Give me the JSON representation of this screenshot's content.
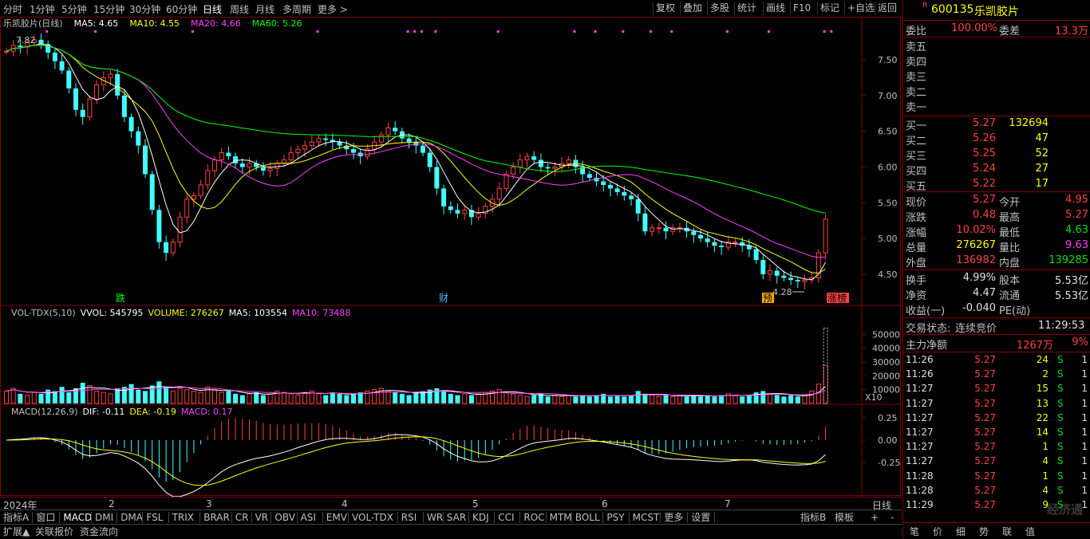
{
  "topbar": {
    "periods": [
      "分时",
      "1分钟",
      "5分钟",
      "15分钟",
      "30分钟",
      "60分钟",
      "日线",
      "周线",
      "月线",
      "多周期",
      "更多 >"
    ],
    "active_period": "日线",
    "tools": [
      "复权",
      "叠加",
      "多股",
      "统计",
      "画线",
      "F10",
      "标记",
      "+自选",
      "返回"
    ]
  },
  "main_chart": {
    "title": "乐凯胶片(日线)",
    "ma_labels": [
      {
        "text": "MA5: 4.65",
        "color": "#ffffff"
      },
      {
        "text": "MA10: 4.55",
        "color": "#ffff00"
      },
      {
        "text": "MA20: 4.66",
        "color": "#ff40ff"
      },
      {
        "text": "MA60: 5.26",
        "color": "#00ff00"
      }
    ],
    "y_ticks": [
      "7.50",
      "7.00",
      "6.50",
      "6.00",
      "5.50",
      "5.00",
      "4.50"
    ],
    "high_label": "7.82",
    "low_label": "4.28",
    "markers": [
      {
        "text": "跌",
        "color": "#00ff00"
      },
      {
        "text": "财",
        "color": "#40c0ff"
      },
      {
        "text": "预",
        "color": "#ffaa00"
      },
      {
        "text": "涨榜",
        "color": "#ff4040"
      }
    ]
  },
  "volume_chart": {
    "header": [
      {
        "text": "VOL-TDX(5,10)",
        "color": "#c0c0c0"
      },
      {
        "text": "VVOL: 545795",
        "color": "#ffffff"
      },
      {
        "text": "VOLUME: 276267",
        "color": "#ffff00"
      },
      {
        "text": "MA5: 103554",
        "color": "#ffffff"
      },
      {
        "text": "MA10: 73488",
        "color": "#ff40ff"
      }
    ],
    "y_ticks": [
      "50000",
      "40000",
      "30000",
      "20000",
      "10000"
    ],
    "unit": "X10"
  },
  "macd_chart": {
    "header": [
      {
        "text": "MACD(12,26,9)",
        "color": "#c0c0c0"
      },
      {
        "text": "DIF: -0.11",
        "color": "#ffffff"
      },
      {
        "text": "DEA: -0.19",
        "color": "#ffff00"
      },
      {
        "text": "MACD: 0.17",
        "color": "#ff40ff"
      }
    ],
    "y_ticks": [
      "0.25",
      "0.00",
      "-0.25"
    ]
  },
  "x_axis": {
    "labels": [
      "2024年",
      "2",
      "3",
      "4",
      "5",
      "6",
      "7"
    ],
    "period": "日线"
  },
  "indicator_tabs": [
    "指标A",
    "窗口",
    "MACD",
    "DMI",
    "DMA",
    "FSL",
    "TRIX",
    "BRAR",
    "CR",
    "VR",
    "OBV",
    "ASI",
    "EMV",
    "VOL-TDX",
    "RSI",
    "WR",
    "SAR",
    "KDJ",
    "CCI",
    "ROC",
    "MTM",
    "BOLL",
    "PSY",
    "MCST",
    "更多",
    "设置"
  ],
  "indicator_right": [
    "指标B",
    "模板",
    "+",
    "-"
  ],
  "bottom_tabs": [
    "扩展▲",
    "关联报价",
    "资金流向"
  ],
  "quote": {
    "badge": "R",
    "code": "600135",
    "name": "乐凯胶片",
    "weibi_label": "委比",
    "weibi_value": "100.00%",
    "weicha_label": "委差",
    "weicha_value": "13.3万",
    "sells": [
      "卖五",
      "卖四",
      "卖三",
      "卖二",
      "卖一"
    ],
    "buys": [
      {
        "label": "买一",
        "price": "5.27",
        "vol": "132694"
      },
      {
        "label": "买二",
        "price": "5.26",
        "vol": "47"
      },
      {
        "label": "买三",
        "price": "5.25",
        "vol": "52"
      },
      {
        "label": "买四",
        "price": "5.24",
        "vol": "27"
      },
      {
        "label": "买五",
        "price": "5.22",
        "vol": "17"
      }
    ],
    "stats": [
      {
        "l1": "现价",
        "v1": "5.27",
        "c1": "#ff4040",
        "l2": "今开",
        "v2": "4.95",
        "c2": "#ff4040"
      },
      {
        "l1": "涨跌",
        "v1": "0.48",
        "c1": "#ff4040",
        "l2": "最高",
        "v2": "5.27",
        "c2": "#ff4040"
      },
      {
        "l1": "涨幅",
        "v1": "10.02%",
        "c1": "#ff4040",
        "l2": "最低",
        "v2": "4.63",
        "c2": "#00e000"
      },
      {
        "l1": "总量",
        "v1": "276267",
        "c1": "#ffff00",
        "l2": "量比",
        "v2": "9.63",
        "c2": "#ff40ff"
      },
      {
        "l1": "外盘",
        "v1": "136982",
        "c1": "#ff4040",
        "l2": "内盘",
        "v2": "139285",
        "c2": "#00e000"
      }
    ],
    "stats2": [
      {
        "l1": "换手",
        "v1": "4.99%",
        "l2": "股本",
        "v2": "5.53亿"
      },
      {
        "l1": "净资",
        "v1": "4.47",
        "l2": "流通",
        "v2": "5.53亿"
      },
      {
        "l1": "收益(一)",
        "v1": "-0.040",
        "l2": "PE(动)",
        "v2": ""
      }
    ],
    "trade_status_label": "交易状态:",
    "trade_status": "连续竞价",
    "trade_time": "11:29:53",
    "main_net_label": "主力净额",
    "main_net_value": "1267万",
    "main_net_pct": "9%",
    "ticks": [
      {
        "t": "11:26",
        "p": "5.27",
        "v": "24",
        "s": "S",
        "n": "1"
      },
      {
        "t": "11:26",
        "p": "5.27",
        "v": "2",
        "s": "S",
        "n": "1"
      },
      {
        "t": "11:27",
        "p": "5.27",
        "v": "15",
        "s": "S",
        "n": "1"
      },
      {
        "t": "11:27",
        "p": "5.27",
        "v": "13",
        "s": "S",
        "n": "1"
      },
      {
        "t": "11:27",
        "p": "5.27",
        "v": "22",
        "s": "S",
        "n": "1"
      },
      {
        "t": "11:27",
        "p": "5.27",
        "v": "14",
        "s": "S",
        "n": "1"
      },
      {
        "t": "11:27",
        "p": "5.27",
        "v": "1",
        "s": "S",
        "n": "1"
      },
      {
        "t": "11:27",
        "p": "5.27",
        "v": "4",
        "s": "S",
        "n": "1"
      },
      {
        "t": "11:28",
        "p": "5.27",
        "v": "1",
        "s": "S",
        "n": "1"
      },
      {
        "t": "11:28",
        "p": "5.27",
        "v": "4",
        "s": "S",
        "n": "1"
      },
      {
        "t": "11:29",
        "p": "5.27",
        "v": "9",
        "s": "S",
        "n": "1"
      }
    ],
    "bottom_tabs": [
      "笔",
      "价",
      "细",
      "势",
      "联",
      "值"
    ]
  },
  "watermark": "经济通",
  "chart_data": {
    "type": "candlestick",
    "y_range": [
      4.28,
      7.82
    ],
    "close_series": [
      7.62,
      7.7,
      7.68,
      7.74,
      7.78,
      7.72,
      7.6,
      7.48,
      7.35,
      7.1,
      6.8,
      6.7,
      6.95,
      7.15,
      7.25,
      7.3,
      7.0,
      6.7,
      6.5,
      6.3,
      5.9,
      5.4,
      4.95,
      4.8,
      4.95,
      5.3,
      5.55,
      5.6,
      5.75,
      5.95,
      6.1,
      6.2,
      6.15,
      6.05,
      6.0,
      6.05,
      6.0,
      5.95,
      5.98,
      6.05,
      6.1,
      6.2,
      6.25,
      6.3,
      6.35,
      6.4,
      6.38,
      6.35,
      6.3,
      6.25,
      6.2,
      6.15,
      6.25,
      6.35,
      6.45,
      6.55,
      6.5,
      6.4,
      6.35,
      6.3,
      6.2,
      6.0,
      5.7,
      5.45,
      5.4,
      5.35,
      5.4,
      5.3,
      5.35,
      5.45,
      5.55,
      5.7,
      5.9,
      6.0,
      6.1,
      6.15,
      6.1,
      6.0,
      5.98,
      6.0,
      6.05,
      6.1,
      6.0,
      5.9,
      5.85,
      5.8,
      5.75,
      5.7,
      5.65,
      5.6,
      5.55,
      5.35,
      5.1,
      5.15,
      5.15,
      5.1,
      5.15,
      5.15,
      5.1,
      5.05,
      5.0,
      4.95,
      4.9,
      4.88,
      4.95,
      4.95,
      4.9,
      4.85,
      4.7,
      4.5,
      4.55,
      4.48,
      4.45,
      4.42,
      4.4,
      4.42,
      4.45,
      4.8,
      5.27
    ],
    "volume_series": [
      9000,
      11000,
      7000,
      6000,
      8000,
      7000,
      10000,
      9000,
      12000,
      8000,
      11000,
      15000,
      13000,
      9000,
      8000,
      7000,
      11000,
      12000,
      14000,
      10000,
      9000,
      13000,
      16000,
      12000,
      9000,
      11000,
      10000,
      9000,
      8000,
      12000,
      10000,
      8000,
      9000,
      7000,
      6000,
      7000,
      8000,
      6000,
      7000,
      9000,
      8000,
      7000,
      6000,
      8000,
      9000,
      7000,
      6000,
      8000,
      7000,
      6000,
      7000,
      8000,
      9000,
      10000,
      11000,
      9000,
      8000,
      7000,
      6000,
      8000,
      9000,
      10000,
      11000,
      9000,
      7000,
      6000,
      7000,
      6000,
      7000,
      8000,
      9000,
      10000,
      8000,
      7000,
      6000,
      5000,
      6000,
      7000,
      5000,
      6000,
      5000,
      6000,
      5000,
      6000,
      5000,
      6000,
      7000,
      5000,
      6000,
      5000,
      6000,
      9000,
      7000,
      6000,
      5000,
      6000,
      5000,
      6000,
      5000,
      6000,
      5000,
      6000,
      5000,
      6000,
      7000,
      6000,
      5000,
      6000,
      8000,
      9000,
      7000,
      6000,
      5000,
      6000,
      5000,
      6000,
      9000,
      14000,
      27627,
      54579
    ]
  }
}
